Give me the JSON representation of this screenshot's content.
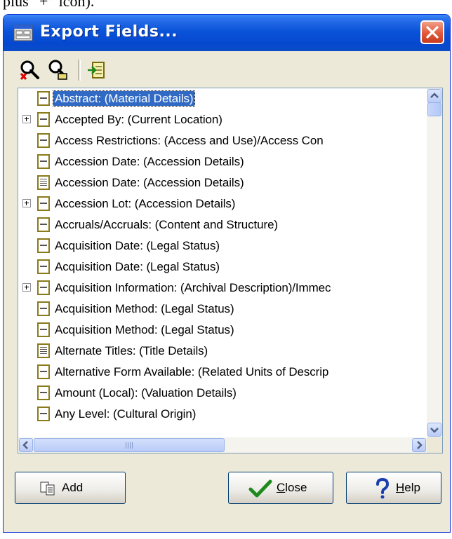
{
  "top_fragment": "plus “+” icon).",
  "window": {
    "title": "Export Fields...",
    "close_label": "Close window"
  },
  "toolbar": {
    "buttons": [
      {
        "icon": "find-field-icon"
      },
      {
        "icon": "find-next-icon"
      },
      {
        "icon": "insert-field-icon"
      }
    ]
  },
  "fields": [
    {
      "label": "Abstract: (Material Details)",
      "icon": "field-icon",
      "expandable": false,
      "selected": true
    },
    {
      "label": "Accepted By: (Current Location)",
      "icon": "field-icon",
      "expandable": true,
      "selected": false
    },
    {
      "label": "Access Restrictions: (Access and Use)/Access Con",
      "icon": "field-icon",
      "expandable": false,
      "selected": false
    },
    {
      "label": "Accession Date: (Accession Details)",
      "icon": "field-icon",
      "expandable": false,
      "selected": false
    },
    {
      "label": "Accession Date: (Accession Details)",
      "icon": "text-field-icon",
      "expandable": false,
      "selected": false
    },
    {
      "label": "Accession Lot: (Accession Details)",
      "icon": "field-icon",
      "expandable": true,
      "selected": false
    },
    {
      "label": "Accruals/Accruals: (Content and Structure)",
      "icon": "field-icon",
      "expandable": false,
      "selected": false
    },
    {
      "label": "Acquisition Date: (Legal Status)",
      "icon": "field-icon",
      "expandable": false,
      "selected": false
    },
    {
      "label": "Acquisition Date: (Legal Status)",
      "icon": "field-icon",
      "expandable": false,
      "selected": false
    },
    {
      "label": "Acquisition Information: (Archival Description)/Immec",
      "icon": "field-icon",
      "expandable": true,
      "selected": false
    },
    {
      "label": "Acquisition Method: (Legal Status)",
      "icon": "field-icon",
      "expandable": false,
      "selected": false
    },
    {
      "label": "Acquisition Method: (Legal Status)",
      "icon": "field-icon",
      "expandable": false,
      "selected": false
    },
    {
      "label": "Alternate Titles: (Title Details)",
      "icon": "text-field-icon",
      "expandable": false,
      "selected": false
    },
    {
      "label": "Alternative Form Available: (Related Units of Descrip",
      "icon": "field-icon",
      "expandable": false,
      "selected": false
    },
    {
      "label": "Amount (Local): (Valuation Details)",
      "icon": "field-icon",
      "expandable": false,
      "selected": false
    },
    {
      "label": "Any Level: (Cultural Origin)",
      "icon": "field-icon",
      "expandable": false,
      "selected": false
    }
  ],
  "scrollbars": {
    "horizontal_grip": "III"
  },
  "buttons": {
    "add": {
      "label": "Add"
    },
    "close": {
      "label_accel": "C",
      "label_rest": "lose"
    },
    "help": {
      "label_accel": "H",
      "label_rest": "elp"
    }
  },
  "colors": {
    "titlebar": "#0a53d9",
    "selection": "#316ac5",
    "dialog_bg": "#ece9d8"
  }
}
